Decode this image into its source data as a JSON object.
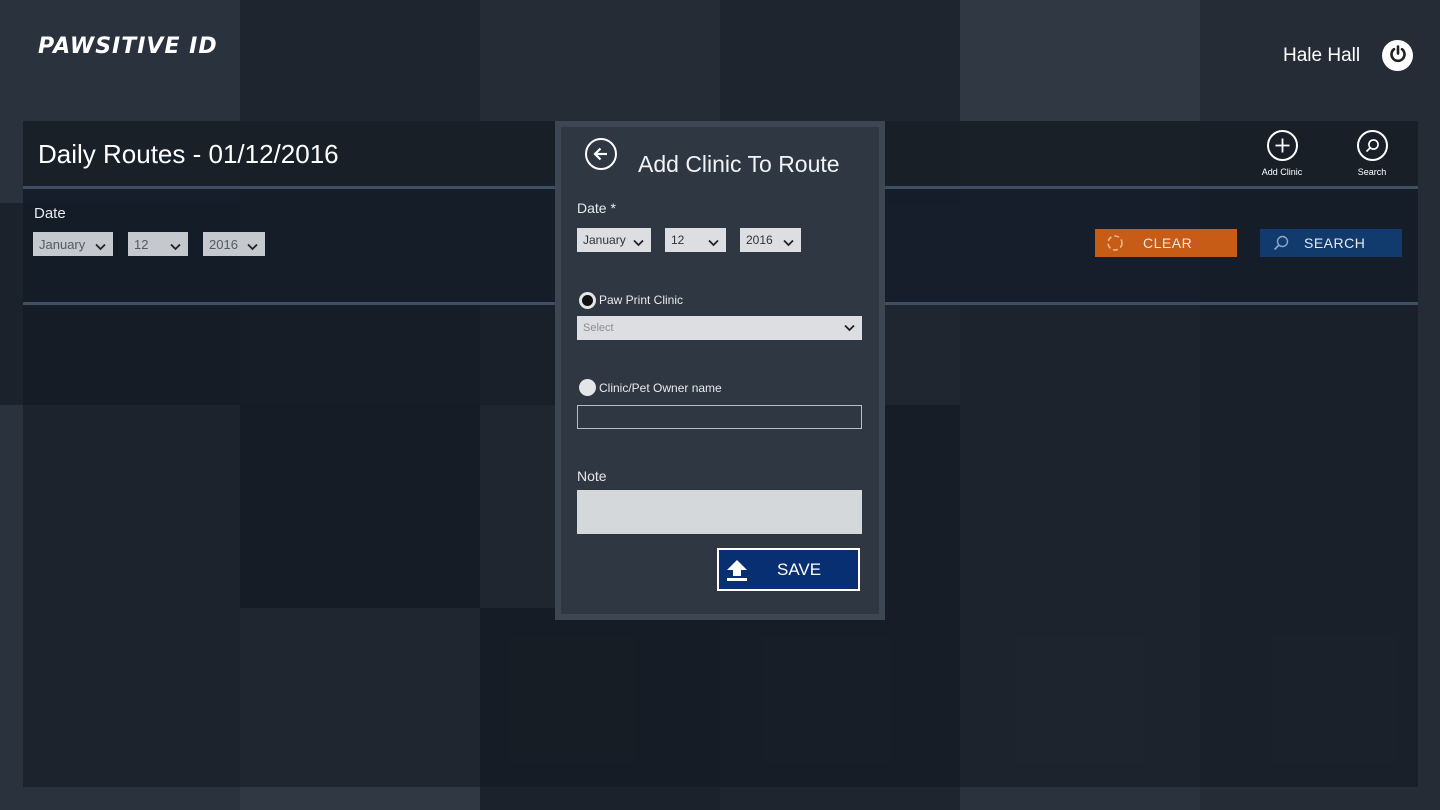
{
  "app": {
    "logo": "PAWSITIVE ID"
  },
  "user": {
    "name": "Hale Hall"
  },
  "icons": {
    "power": "power-icon",
    "add_clinic": "plus-icon",
    "search": "magnifier-icon",
    "back": "arrow-left-icon",
    "clear": "refresh-icon",
    "save": "upload-icon",
    "chevron": "chevron-down-icon"
  },
  "colors": {
    "clear_button": "#c65c16",
    "search_button": "#123b6d",
    "save_button": "#082f72"
  },
  "page": {
    "title": "Daily Routes -  01/12/2016"
  },
  "appbar": {
    "add_clinic_label": "Add Clinic",
    "search_label": "Search"
  },
  "filters": {
    "date_label": "Date",
    "month": "January",
    "day": "12",
    "year": "2016",
    "clear_label": "CLEAR",
    "search_label": "SEARCH"
  },
  "modal": {
    "title": "Add Clinic To Route",
    "date_label": "Date *",
    "month": "January",
    "day": "12",
    "year": "2016",
    "option1_label": "Paw Print Clinic",
    "option1_selected": true,
    "clinic_select_placeholder": "Select",
    "option2_label": "Clinic/Pet Owner name",
    "owner_name_value": "",
    "note_label": "Note",
    "note_value": "",
    "save_label": "SAVE"
  }
}
